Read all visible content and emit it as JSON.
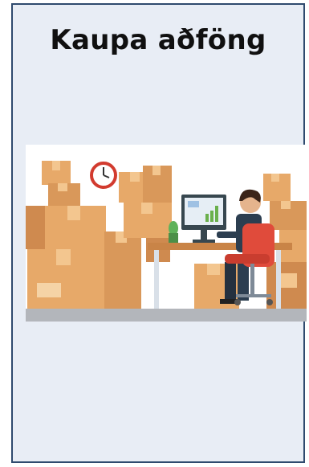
{
  "tile": {
    "title": "Kaupa aðföng",
    "illustration_icon": "warehouse-office-worker-illustration"
  },
  "colors": {
    "border": "#2f4a6e",
    "card_background": "#e8edf5",
    "box": "#e7a969",
    "box_dark": "#cf8a4f",
    "chair": "#e04b3b",
    "floor": "#b3b6bb"
  }
}
